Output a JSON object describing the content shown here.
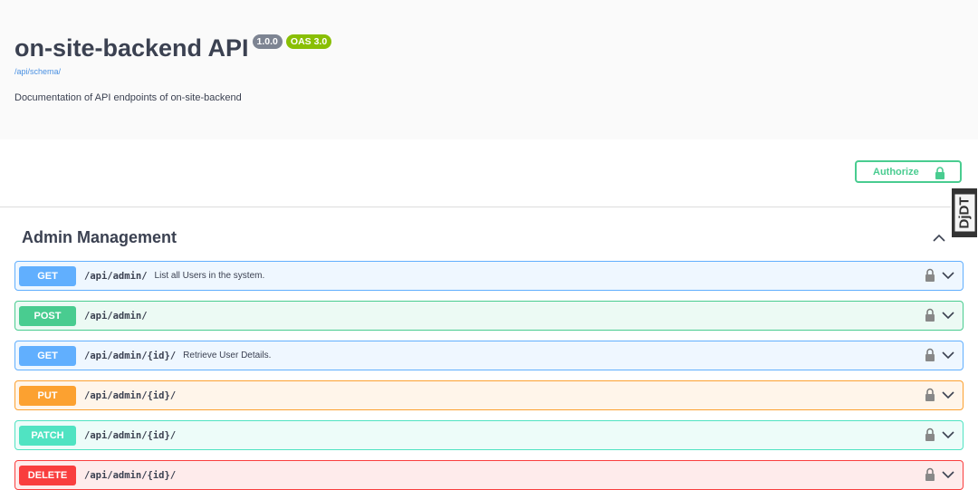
{
  "info": {
    "title": "on-site-backend API",
    "version": "1.0.0",
    "oas": "OAS 3.0",
    "schema_link": "/api/schema/",
    "description": "Documentation of API endpoints of on-site-backend"
  },
  "authorize": {
    "label": "Authorize"
  },
  "debug_toolbar": {
    "label": "DjDT"
  },
  "tag": {
    "name": "Admin Management"
  },
  "operations": [
    {
      "method": "GET",
      "path": "/api/admin/",
      "summary": "List all Users in the system."
    },
    {
      "method": "POST",
      "path": "/api/admin/",
      "summary": ""
    },
    {
      "method": "GET",
      "path": "/api/admin/{id}/",
      "summary": "Retrieve User Details."
    },
    {
      "method": "PUT",
      "path": "/api/admin/{id}/",
      "summary": ""
    },
    {
      "method": "PATCH",
      "path": "/api/admin/{id}/",
      "summary": ""
    },
    {
      "method": "DELETE",
      "path": "/api/admin/{id}/",
      "summary": ""
    }
  ],
  "colors": {
    "get": "#61affe",
    "post": "#49cc90",
    "put": "#fca130",
    "patch": "#50e3c2",
    "delete": "#f93e3e"
  }
}
